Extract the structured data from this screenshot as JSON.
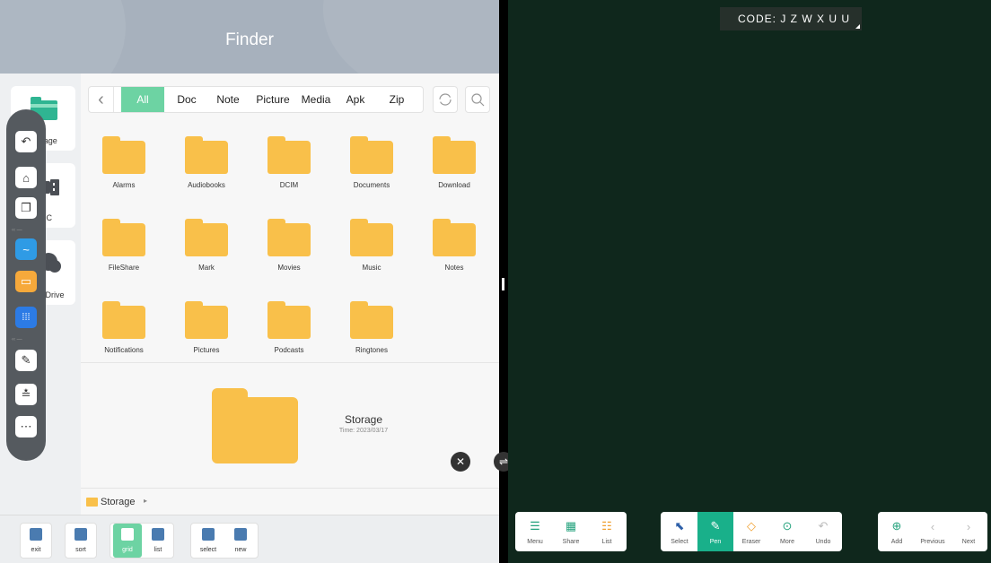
{
  "header": {
    "title": "Finder"
  },
  "drives": [
    {
      "label": "Storage"
    },
    {
      "label": "DOC"
    },
    {
      "label": "Cloud Drive"
    }
  ],
  "filter": {
    "tabs": [
      "All",
      "Doc",
      "Note",
      "Picture",
      "Media",
      "Apk",
      "Zip"
    ],
    "active": "All"
  },
  "folders": [
    "Alarms",
    "Audiobooks",
    "DCIM",
    "Documents",
    "Download",
    "FileShare",
    "Mark",
    "Movies",
    "Music",
    "Notes",
    "Notifications",
    "Pictures",
    "Podcasts",
    "Ringtones"
  ],
  "detail": {
    "name": "Storage",
    "time": "Time: 2023/03/17"
  },
  "path": {
    "current": "Storage",
    "chevron": "▸"
  },
  "finder_toolbar": [
    {
      "label": "exit"
    },
    {
      "label": "sort"
    },
    {
      "label": "grid"
    },
    {
      "label": "list"
    },
    {
      "label": "select"
    },
    {
      "label": "new"
    }
  ],
  "whiteboard": {
    "code": "CODE: J Z W X U U",
    "group1": [
      {
        "label": "Menu",
        "icon": "menu-icon"
      },
      {
        "label": "Share",
        "icon": "qr-icon"
      },
      {
        "label": "List",
        "icon": "list-icon"
      }
    ],
    "group2": [
      {
        "label": "Select",
        "icon": "cursor-icon"
      },
      {
        "label": "Pen",
        "icon": "pen-icon"
      },
      {
        "label": "Eraser",
        "icon": "eraser-icon"
      },
      {
        "label": "More",
        "icon": "more-icon"
      },
      {
        "label": "Undo",
        "icon": "undo-icon"
      }
    ],
    "group3": [
      {
        "label": "Add",
        "icon": "add-icon"
      },
      {
        "label": "Previous",
        "icon": "chevron-left-icon"
      },
      {
        "label": "Next",
        "icon": "chevron-right-icon"
      }
    ]
  },
  "colors": {
    "accent": "#6dd3a3",
    "folder": "#f9c04a",
    "board": "#0f271c",
    "pen_active": "#19b08a"
  }
}
